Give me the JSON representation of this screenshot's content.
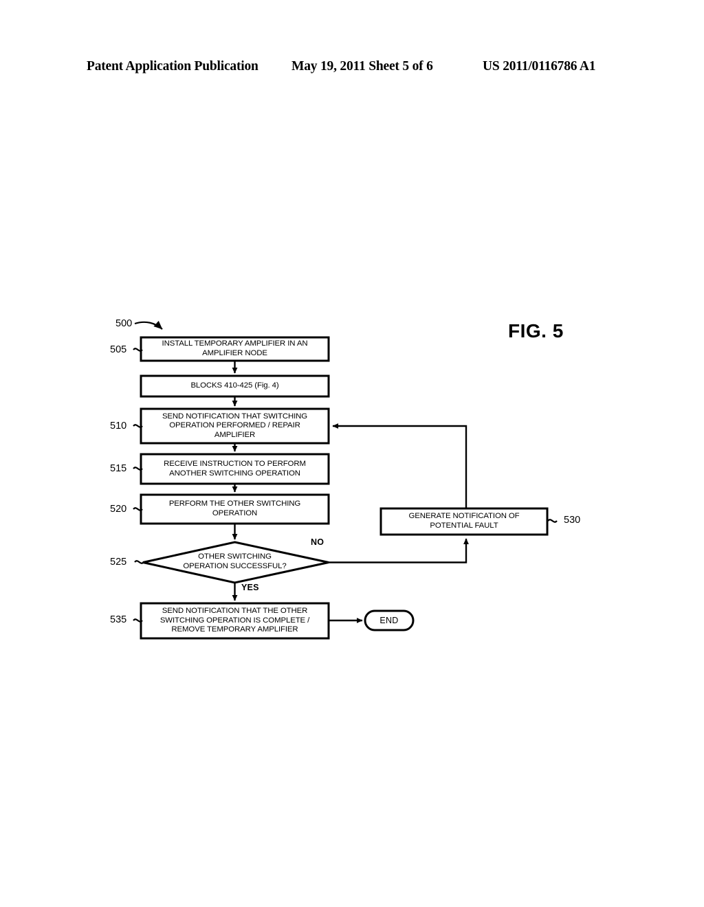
{
  "header": {
    "left": "Patent Application Publication",
    "middle": "May 19, 2011  Sheet 5 of 6",
    "right": "US 2011/0116786 A1"
  },
  "figure": {
    "label": "FIG. 5",
    "diagram_ref": "500"
  },
  "nodes": {
    "n505": {
      "ref": "505",
      "text": "INSTALL TEMPORARY AMPLIFIER IN AN\nAMPLIFIER NODE"
    },
    "n_blocks": {
      "ref": "",
      "text": "BLOCKS 410-425 (Fig. 4)"
    },
    "n510": {
      "ref": "510",
      "text": "SEND NOTIFICATION THAT SWITCHING\nOPERATION PERFORMED / REPAIR\nAMPLIFIER"
    },
    "n515": {
      "ref": "515",
      "text": "RECEIVE INSTRUCTION TO PERFORM\nANOTHER SWITCHING OPERATION"
    },
    "n520": {
      "ref": "520",
      "text": "PERFORM THE OTHER SWITCHING\nOPERATION"
    },
    "n525": {
      "ref": "525",
      "text": "OTHER SWITCHING\nOPERATION SUCCESSFUL?"
    },
    "n530": {
      "ref": "530",
      "text": "GENERATE NOTIFICATION OF\nPOTENTIAL FAULT"
    },
    "n535": {
      "ref": "535",
      "text": "SEND NOTIFICATION THAT THE OTHER\nSWITCHING OPERATION IS COMPLETE /\nREMOVE TEMPORARY AMPLIFIER"
    },
    "n_end": {
      "ref": "",
      "text": "END"
    }
  },
  "edge_labels": {
    "no": "NO",
    "yes": "YES"
  },
  "colors": {
    "ink": "#000000",
    "paper": "#ffffff"
  }
}
